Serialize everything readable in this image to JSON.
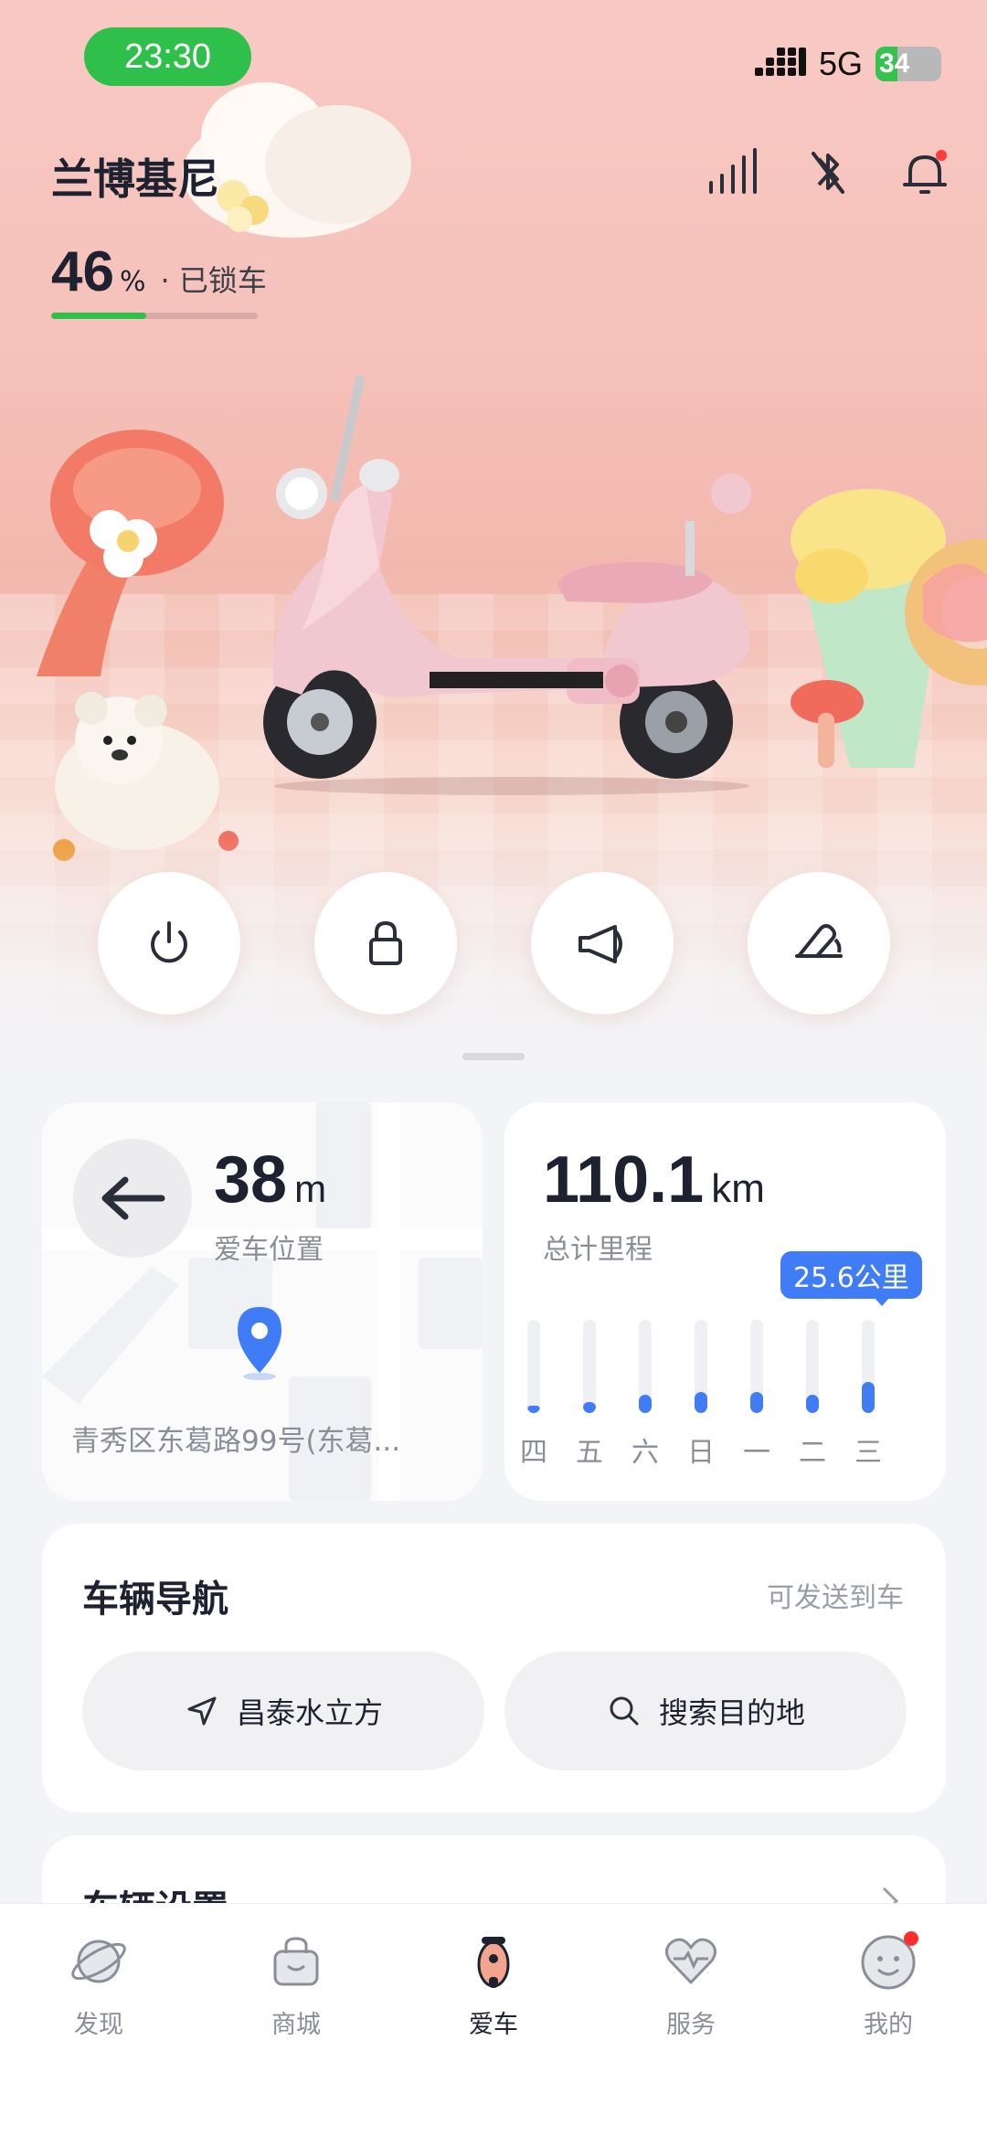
{
  "status_bar": {
    "time": "23:30",
    "network": "5G",
    "battery": "34",
    "battery_level": 0.34
  },
  "header": {
    "vehicle_name": "兰博基尼",
    "battery_percent": "46",
    "battery_unit": "%",
    "battery_level": 0.46,
    "lock_status": "· 已锁车"
  },
  "header_icons": [
    "signal-strength-icon",
    "bluetooth-off-icon",
    "bell-icon"
  ],
  "controls": [
    {
      "name": "power-button",
      "icon": "power-icon"
    },
    {
      "name": "lock-button",
      "icon": "lock-icon"
    },
    {
      "name": "horn-button",
      "icon": "horn-icon"
    },
    {
      "name": "seat-button",
      "icon": "seat-icon"
    }
  ],
  "location": {
    "distance": "38",
    "unit": "m",
    "label": "爱车位置",
    "address": "青秀区东葛路99号(东葛..."
  },
  "mileage": {
    "total": "110.1",
    "unit": "km",
    "label": "总计里程",
    "tooltip": "25.6公里",
    "days": [
      {
        "label": "四",
        "value": 0.06
      },
      {
        "label": "五",
        "value": 0.12
      },
      {
        "label": "六",
        "value": 0.2
      },
      {
        "label": "日",
        "value": 0.23
      },
      {
        "label": "一",
        "value": 0.23
      },
      {
        "label": "二",
        "value": 0.2
      },
      {
        "label": "三",
        "value": 0.33
      }
    ]
  },
  "navigation": {
    "title": "车辆导航",
    "hint": "可发送到车",
    "destination": "昌泰水立方",
    "search": "搜索目的地"
  },
  "settings": {
    "title": "车辆设置"
  },
  "tabs": [
    {
      "label": "发现",
      "icon": "planet-icon",
      "active": false
    },
    {
      "label": "商城",
      "icon": "shopping-bag-icon",
      "active": false
    },
    {
      "label": "爱车",
      "icon": "scooter-icon",
      "active": true
    },
    {
      "label": "服务",
      "icon": "heart-icon",
      "active": false
    },
    {
      "label": "我的",
      "icon": "smiley-face-icon",
      "active": false
    }
  ],
  "colors": {
    "accent": "#3f7cf6",
    "battery": "#2fbf4b",
    "badge": "#ff3b3b"
  }
}
